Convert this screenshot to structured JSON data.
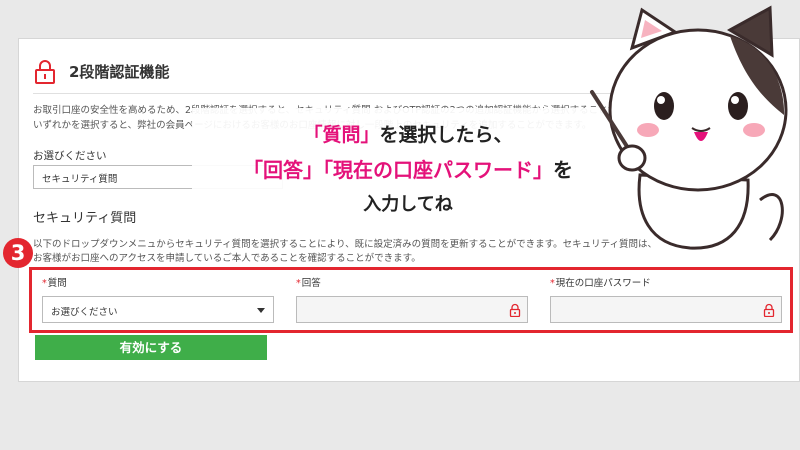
{
  "panel": {
    "title": "2段階認証機能",
    "intro_line1": "お取引口座の安全性を高めるため、2段階認証を選択すると、セキュリティ質問 およびOTP認証の2つの追加認証機能から選択することができます。",
    "intro_line2": "いずれかを選択すると、弊社の会員ページにおけるお客様のお口座情報に対し一段階上のセキュリティを追加することができます。"
  },
  "method": {
    "label": "お選びください",
    "selected": "セキュリティ質問"
  },
  "security": {
    "title": "セキュリティ質問",
    "desc_line1": "以下のドロップダウンメニュからセキュリティ質問を選択することにより、既に設定済みの質問を更新することができます。セキュリティ質問は、",
    "desc_line2": "お客様がお口座へのアクセスを申請しているご本人であることを確認することができます。"
  },
  "fields": {
    "required_mark": "*",
    "question_label": "質問",
    "question_value": "お選びください",
    "answer_label": "回答",
    "password_label": "現在の口座パスワード"
  },
  "submit_label": "有効にする",
  "step_number": "3",
  "callout": {
    "l1_pink": "「質問」",
    "l1_rest": "を選択したら、",
    "l2_pink": "「回答」「現在の口座パスワード」",
    "l2_rest": "を",
    "l3": "入力してね"
  },
  "colors": {
    "accent_red": "#e3262f",
    "button_green": "#3fae49",
    "callout_pink": "#e4127a"
  },
  "icons": [
    "lock-icon",
    "caret-down-icon",
    "eye-icon",
    "cat-mascot"
  ]
}
